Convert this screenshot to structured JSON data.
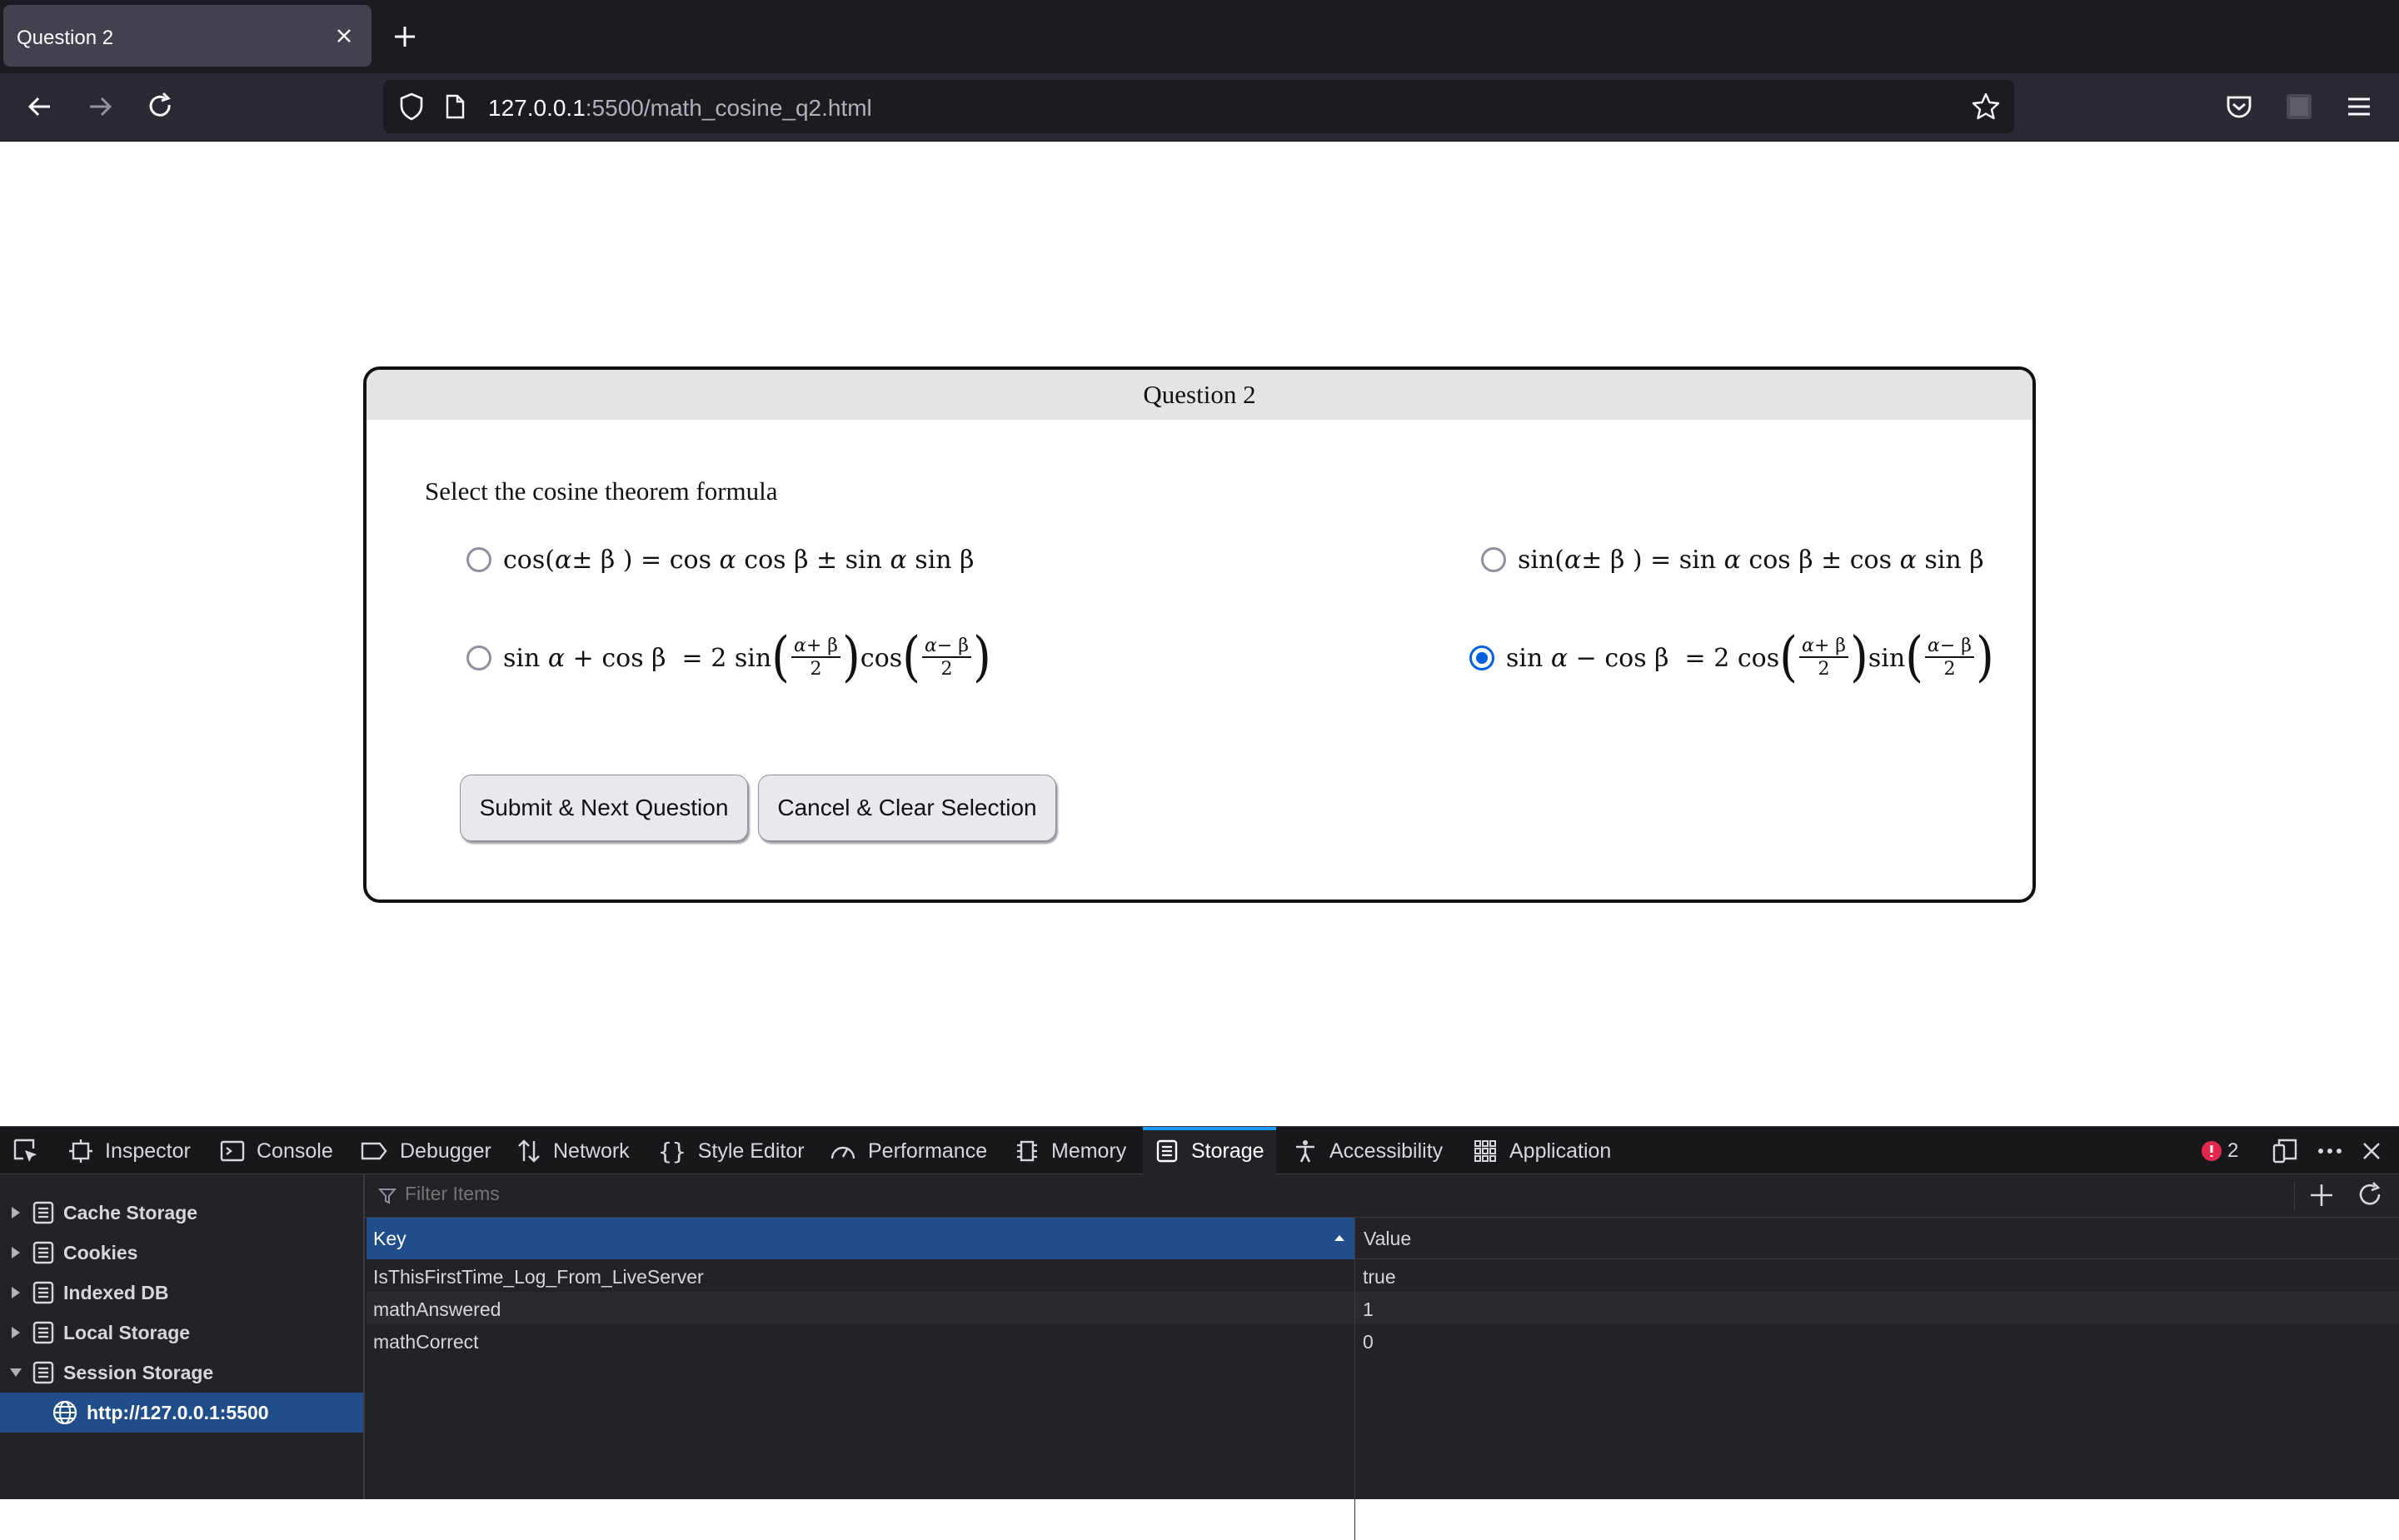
{
  "browser": {
    "tab_title": "Question 2",
    "url_host": "127.0.0.1",
    "url_rest": ":5500/math_cosine_q2.html"
  },
  "quiz": {
    "header": "Question 2",
    "prompt": "Select the cosine theorem formula",
    "options": [
      {
        "id": "opt1",
        "text": "cos(α± β ) = cos α cos β ± sin α sin β",
        "checked": false
      },
      {
        "id": "opt2",
        "text": "sin(α± β ) = sin α cos β ± cos α sin β",
        "checked": false
      },
      {
        "id": "opt3",
        "text": "sin α + cos β = 2 sin((α+β)/2) cos((α−β)/2)",
        "checked": false
      },
      {
        "id": "opt4",
        "text": "sin α − cos β = 2 cos((α+β)/2) sin((α−β)/2)",
        "checked": true
      }
    ],
    "submit_label": "Submit & Next Question",
    "cancel_label": "Cancel & Clear Selection"
  },
  "devtools": {
    "tabs": [
      "Inspector",
      "Console",
      "Debugger",
      "Network",
      "Style Editor",
      "Performance",
      "Memory",
      "Storage",
      "Accessibility",
      "Application"
    ],
    "active_tab": "Storage",
    "error_count": "2",
    "filter_placeholder": "Filter Items",
    "tree": [
      "Cache Storage",
      "Cookies",
      "Indexed DB",
      "Local Storage",
      "Session Storage"
    ],
    "tree_child": "http://127.0.0.1:5500",
    "columns": {
      "key": "Key",
      "value": "Value"
    },
    "rows": [
      {
        "key": "IsThisFirstTime_Log_From_LiveServer",
        "value": "true"
      },
      {
        "key": "mathAnswered",
        "value": "1"
      },
      {
        "key": "mathCorrect",
        "value": "0"
      }
    ]
  },
  "colors": {
    "accent": "#0060df",
    "selection": "#204e8a",
    "tab_active": "#1a9bf8"
  }
}
